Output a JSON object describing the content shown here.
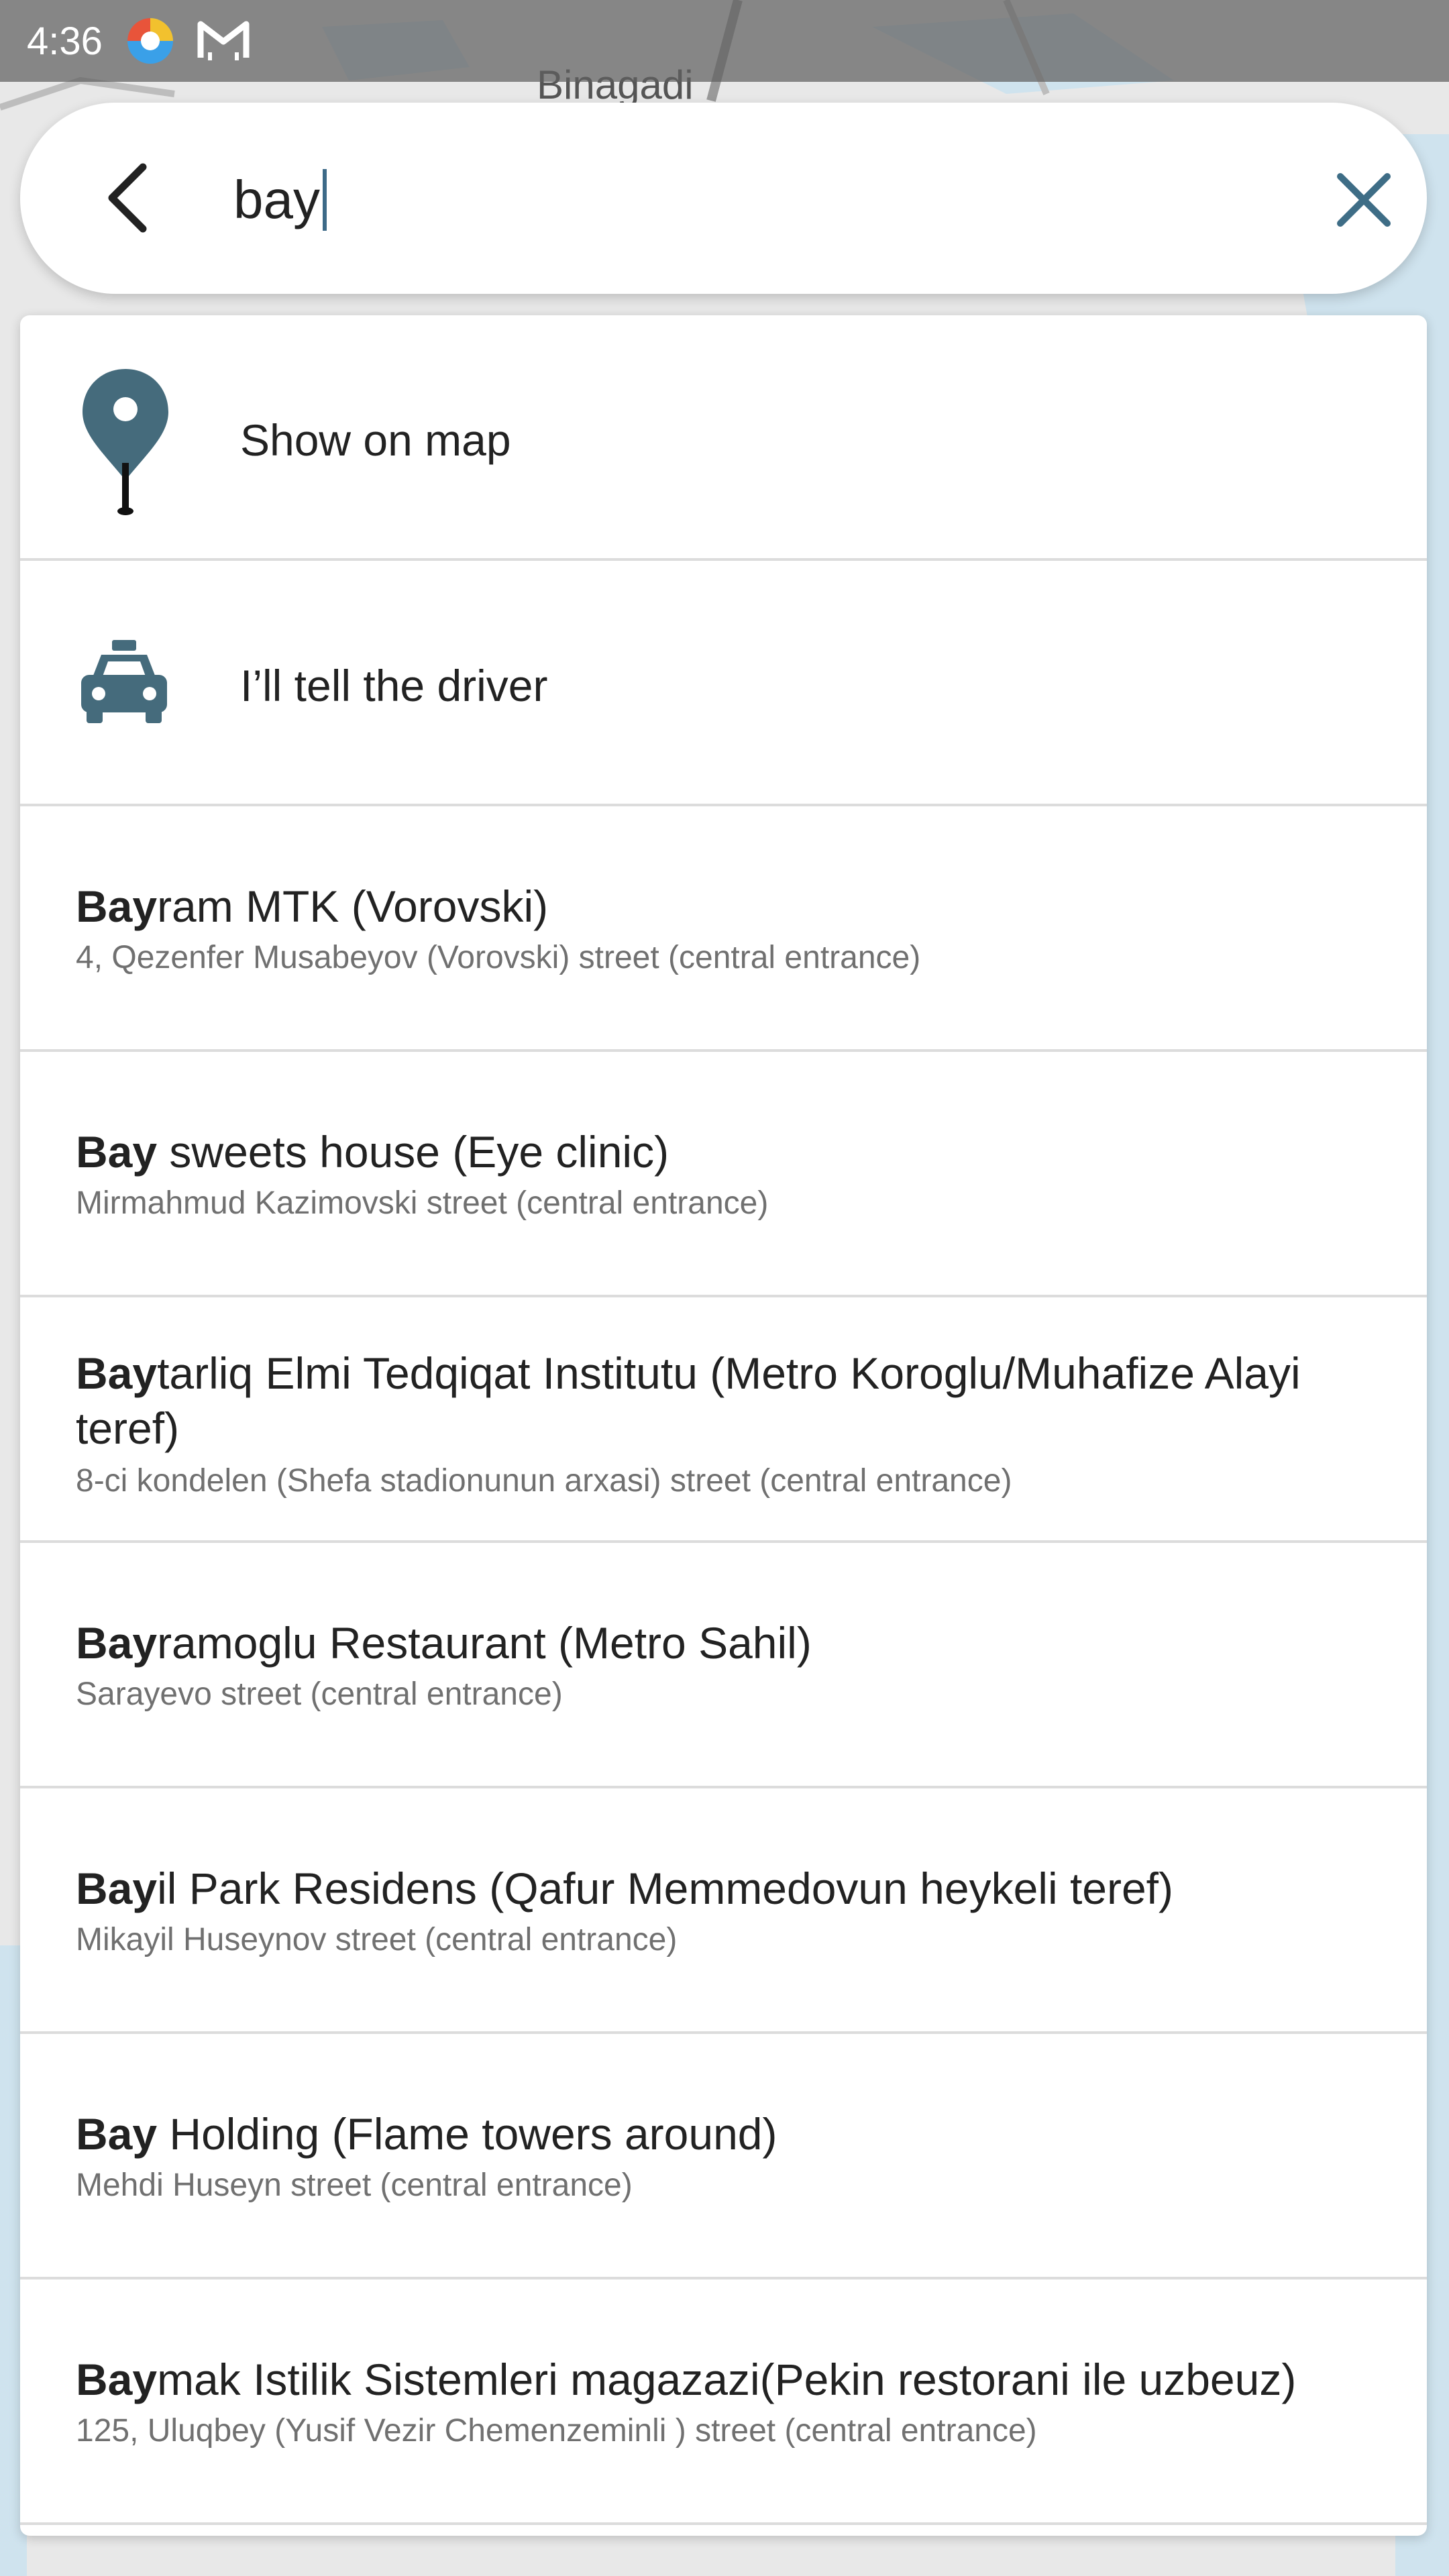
{
  "status_bar": {
    "time": "4:36"
  },
  "map": {
    "label": "Binagadi"
  },
  "search": {
    "query": "bay"
  },
  "actions": [
    {
      "label": "Show on map",
      "icon": "map-pin-icon"
    },
    {
      "label": "I’ll tell the driver",
      "icon": "taxi-icon"
    }
  ],
  "results": [
    {
      "match": "Bay",
      "rest": "ram MTK (Vorovski)",
      "address": "4, Qezenfer Musabeyov (Vorovski) street (central entrance)"
    },
    {
      "match": "Bay",
      "rest": " sweets house (Eye clinic)",
      "address": "Mirmahmud Kazimovski street (central entrance)"
    },
    {
      "match": "Bay",
      "rest": "tarliq Elmi Tedqiqat Institutu (Metro Koroglu/Muhafize Alayi teref)",
      "address": "8-ci kondelen (Shefa stadionunun arxasi) street (central entrance)"
    },
    {
      "match": "Bay",
      "rest": "ramoglu Restaurant (Metro Sahil)",
      "address": "Sarayevo street (central entrance)"
    },
    {
      "match": "Bay",
      "rest": "il Park Residens (Qafur Memmedovun heykeli teref)",
      "address": "Mikayil Huseynov street (central entrance)"
    },
    {
      "match": "Bay",
      "rest": " Holding (Flame towers around)",
      "address": "Mehdi Huseyn street (central entrance)"
    },
    {
      "match": "Bay",
      "rest": "mak Istilik Sistemleri magazazi(Pekin restorani ile uzbeuz)",
      "address": "125, Uluqbey (Yusif Vezir Chemenzeminli ) street (central entrance)"
    }
  ],
  "colors": {
    "accent": "#456b7c",
    "caret": "#3d6a88",
    "clear": "#3e6d86"
  }
}
